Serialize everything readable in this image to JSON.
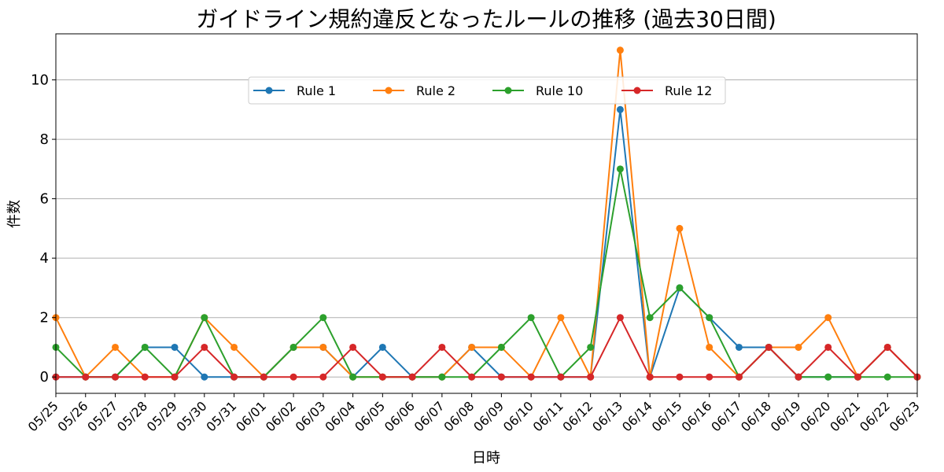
{
  "chart_data": {
    "type": "line",
    "title": "ガイドライン規約違反となったルールの推移 (過去30日間)",
    "xlabel": "日時",
    "ylabel": "件数",
    "ylim": [
      -0.55,
      11.55
    ],
    "yticks": [
      0,
      2,
      4,
      6,
      8,
      10
    ],
    "grid": "y",
    "legend": "top-center",
    "categories": [
      "05/25",
      "05/26",
      "05/27",
      "05/28",
      "05/29",
      "05/30",
      "05/31",
      "06/01",
      "06/02",
      "06/03",
      "06/04",
      "06/05",
      "06/06",
      "06/07",
      "06/08",
      "06/09",
      "06/10",
      "06/11",
      "06/12",
      "06/13",
      "06/14",
      "06/15",
      "06/16",
      "06/17",
      "06/18",
      "06/19",
      "06/20",
      "06/21",
      "06/22",
      "06/23"
    ],
    "series": [
      {
        "name": "Rule 1",
        "color": "#1f77b4",
        "values": [
          0,
          0,
          0,
          1,
          1,
          0,
          0,
          0,
          1,
          1,
          0,
          1,
          0,
          0,
          1,
          0,
          0,
          0,
          0,
          9,
          0,
          3,
          2,
          1,
          1,
          0,
          0,
          0,
          1,
          0
        ]
      },
      {
        "name": "Rule 2",
        "color": "#ff7f0e",
        "values": [
          2,
          0,
          1,
          0,
          0,
          2,
          1,
          0,
          1,
          1,
          0,
          0,
          0,
          0,
          1,
          1,
          0,
          2,
          0,
          11,
          0,
          5,
          1,
          0,
          1,
          1,
          2,
          0,
          1,
          0
        ]
      },
      {
        "name": "Rule 10",
        "color": "#2ca02c",
        "values": [
          1,
          0,
          0,
          1,
          0,
          2,
          0,
          0,
          1,
          2,
          0,
          0,
          0,
          0,
          0,
          1,
          2,
          0,
          1,
          7,
          2,
          3,
          2,
          0,
          1,
          0,
          0,
          0,
          0,
          0
        ]
      },
      {
        "name": "Rule 12",
        "color": "#d62728",
        "values": [
          0,
          0,
          0,
          0,
          0,
          1,
          0,
          0,
          0,
          0,
          1,
          0,
          0,
          1,
          0,
          0,
          0,
          0,
          0,
          2,
          0,
          0,
          0,
          0,
          1,
          0,
          1,
          0,
          1,
          0
        ]
      }
    ]
  }
}
